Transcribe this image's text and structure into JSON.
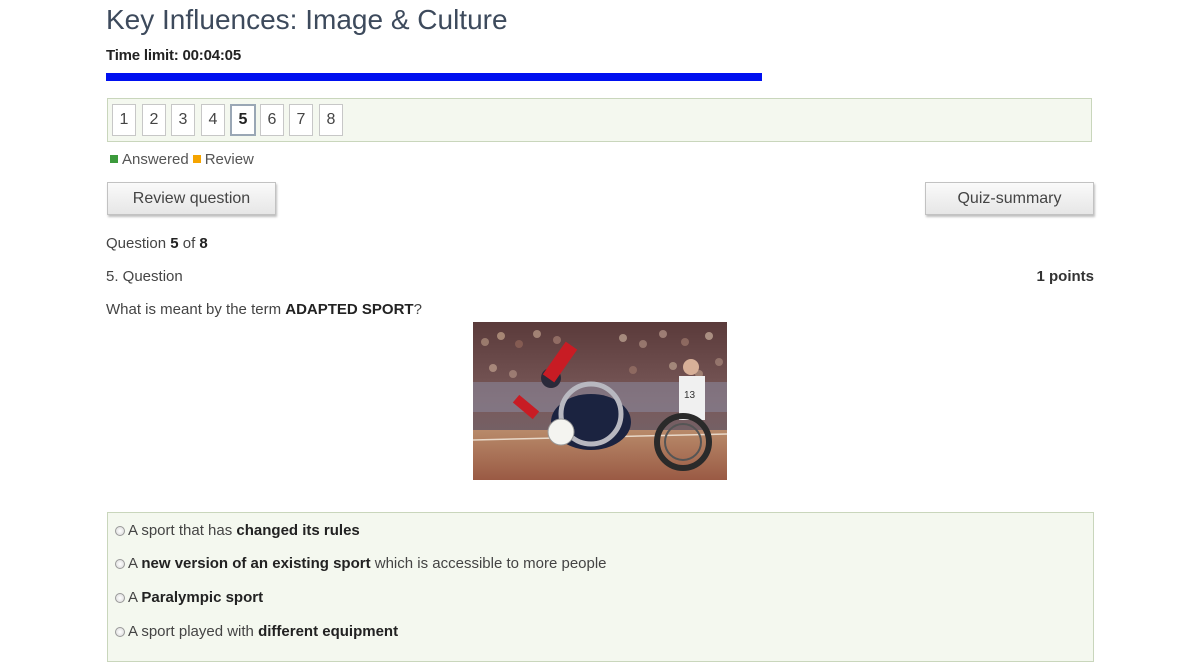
{
  "quiz": {
    "title": "Key Influences: Image & Culture",
    "time_limit_label": "Time limit:",
    "time_remaining": "00:04:05",
    "time_remaining_fraction": 0.815
  },
  "navigation": {
    "questions": [
      "1",
      "2",
      "3",
      "4",
      "5",
      "6",
      "7",
      "8"
    ],
    "current": "5"
  },
  "legend": {
    "answered_label": "Answered",
    "answered_color": "#3c9a3c",
    "review_label": "Review",
    "review_color": "#f5a400"
  },
  "buttons": {
    "review": "Review question",
    "summary": "Quiz-summary"
  },
  "question": {
    "count_prefix": "Question",
    "current": "5",
    "of": "of",
    "total": "8",
    "heading": "5. Question",
    "points": "1 points",
    "text_before": "What is meant by the term",
    "text_bold": "ADAPTED SPORT",
    "text_after": "?"
  },
  "answers": [
    {
      "parts": [
        {
          "t": "A sport that has ",
          "b": false
        },
        {
          "t": "changed its rules",
          "b": true
        }
      ]
    },
    {
      "parts": [
        {
          "t": "A ",
          "b": false
        },
        {
          "t": "new version of an existing sport",
          "b": true
        },
        {
          "t": " which is accessible to more people",
          "b": false
        }
      ]
    },
    {
      "parts": [
        {
          "t": "A ",
          "b": false
        },
        {
          "t": "Paralympic sport",
          "b": true
        }
      ]
    },
    {
      "parts": [
        {
          "t": "A sport played with ",
          "b": false
        },
        {
          "t": "different equipment",
          "b": true
        }
      ]
    }
  ],
  "photo": {
    "jersey_number": "13"
  }
}
